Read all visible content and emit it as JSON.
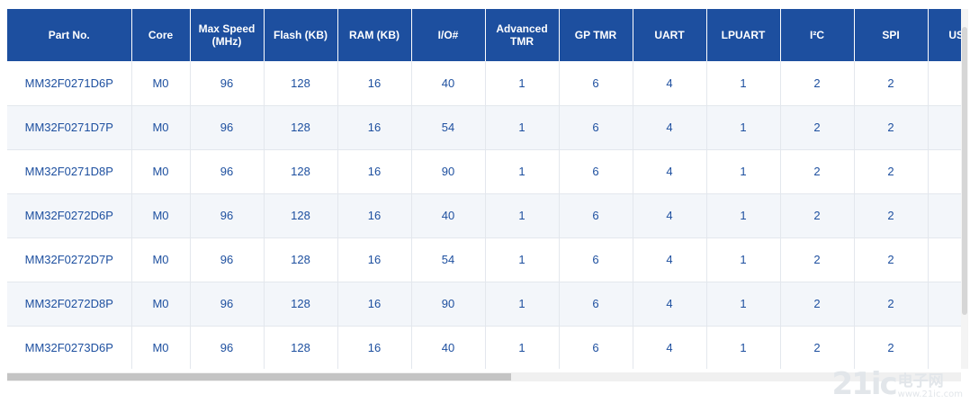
{
  "colors": {
    "header_bg": "#1d4f9f",
    "cell_text": "#1d4f9f",
    "alt_row": "#f3f6fa"
  },
  "table": {
    "headers": [
      {
        "key": "part",
        "line1": "Part No.",
        "line2": ""
      },
      {
        "key": "core",
        "line1": "Core",
        "line2": ""
      },
      {
        "key": "speed",
        "line1": "Max Speed",
        "line2": "(MHz)"
      },
      {
        "key": "flash",
        "line1": "Flash (KB)",
        "line2": ""
      },
      {
        "key": "ram",
        "line1": "RAM (KB)",
        "line2": ""
      },
      {
        "key": "io",
        "line1": "I/O#",
        "line2": ""
      },
      {
        "key": "advtmr",
        "line1": "Advanced",
        "line2": "TMR"
      },
      {
        "key": "gptmr",
        "line1": "GP TMR",
        "line2": ""
      },
      {
        "key": "uart",
        "line1": "UART",
        "line2": ""
      },
      {
        "key": "lpuart",
        "line1": "LPUART",
        "line2": ""
      },
      {
        "key": "i2c",
        "line1": "I²C",
        "line2": ""
      },
      {
        "key": "spi",
        "line1": "SPI",
        "line2": ""
      },
      {
        "key": "usb",
        "line1": "USB",
        "line2": ""
      }
    ],
    "rows": [
      [
        "MM32F0271D6P",
        "M0",
        "96",
        "128",
        "16",
        "40",
        "1",
        "6",
        "4",
        "1",
        "2",
        "2",
        ""
      ],
      [
        "MM32F0271D7P",
        "M0",
        "96",
        "128",
        "16",
        "54",
        "1",
        "6",
        "4",
        "1",
        "2",
        "2",
        ""
      ],
      [
        "MM32F0271D8P",
        "M0",
        "96",
        "128",
        "16",
        "90",
        "1",
        "6",
        "4",
        "1",
        "2",
        "2",
        ""
      ],
      [
        "MM32F0272D6P",
        "M0",
        "96",
        "128",
        "16",
        "40",
        "1",
        "6",
        "4",
        "1",
        "2",
        "2",
        ""
      ],
      [
        "MM32F0272D7P",
        "M0",
        "96",
        "128",
        "16",
        "54",
        "1",
        "6",
        "4",
        "1",
        "2",
        "2",
        ""
      ],
      [
        "MM32F0272D8P",
        "M0",
        "96",
        "128",
        "16",
        "90",
        "1",
        "6",
        "4",
        "1",
        "2",
        "2",
        ""
      ],
      [
        "MM32F0273D6P",
        "M0",
        "96",
        "128",
        "16",
        "40",
        "1",
        "6",
        "4",
        "1",
        "2",
        "2",
        ""
      ]
    ]
  },
  "watermark": {
    "number": "21ic",
    "name": "电子网",
    "url": "www.21ic.com"
  }
}
